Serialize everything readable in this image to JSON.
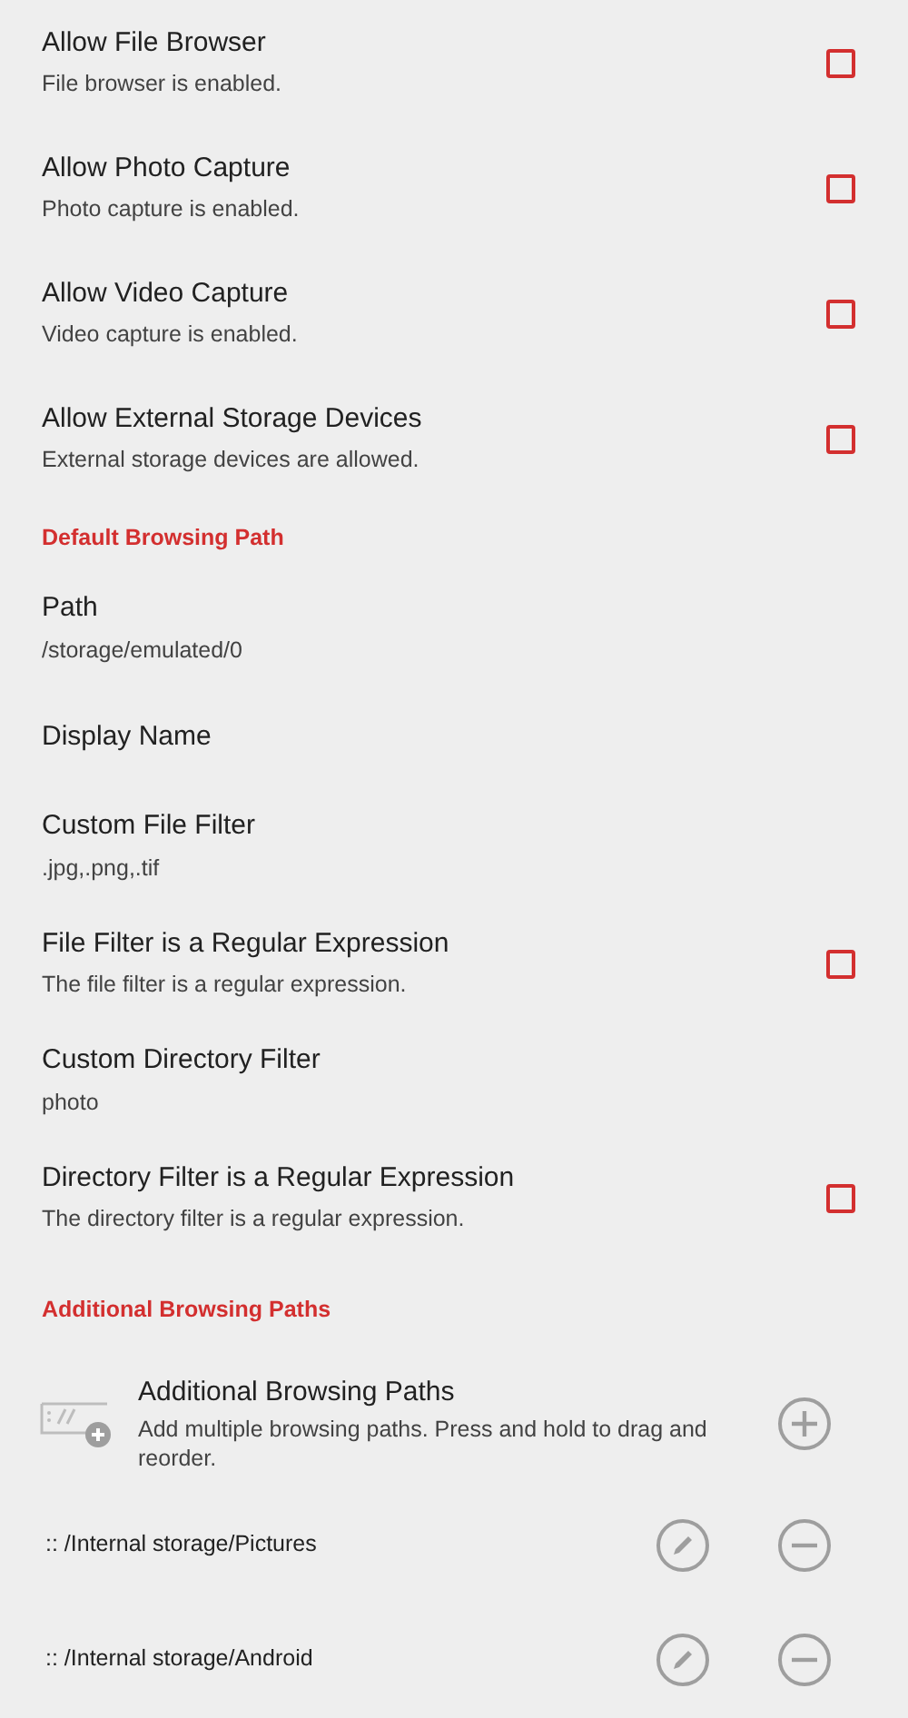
{
  "settings": [
    {
      "kind": "checkbox",
      "title": "Allow File Browser",
      "summary": "File browser is enabled.",
      "checked": false
    },
    {
      "kind": "checkbox",
      "title": "Allow Photo Capture",
      "summary": "Photo capture is enabled.",
      "checked": false
    },
    {
      "kind": "checkbox",
      "title": "Allow Video Capture",
      "summary": "Video capture is enabled.",
      "checked": false
    },
    {
      "kind": "checkbox",
      "title": "Allow External Storage Devices",
      "summary": "External storage devices are allowed.",
      "checked": false
    },
    {
      "kind": "header",
      "title": "Default Browsing Path"
    },
    {
      "kind": "text",
      "title": "Path",
      "summary": "/storage/emulated/0"
    },
    {
      "kind": "text",
      "title": "Display Name"
    },
    {
      "kind": "text",
      "title": "Custom File Filter",
      "summary": ".jpg,.png,.tif"
    },
    {
      "kind": "checkbox",
      "title": "File Filter is a Regular Expression",
      "summary": "The file filter is a regular expression.",
      "checked": false
    },
    {
      "kind": "text",
      "title": "Custom Directory Filter",
      "summary": "photo"
    },
    {
      "kind": "checkbox",
      "title": "Directory Filter is a Regular Expression",
      "summary": "The directory filter is a regular expression.",
      "checked": false
    },
    {
      "kind": "header",
      "title": "Additional Browsing Paths"
    },
    {
      "kind": "add",
      "title": "Additional Browsing Paths",
      "summary": "Add multiple browsing paths. Press and hold to drag and reorder."
    },
    {
      "kind": "path",
      "title": ":: /Internal storage/Pictures"
    },
    {
      "kind": "path",
      "title": ":: /Internal storage/Android"
    }
  ]
}
